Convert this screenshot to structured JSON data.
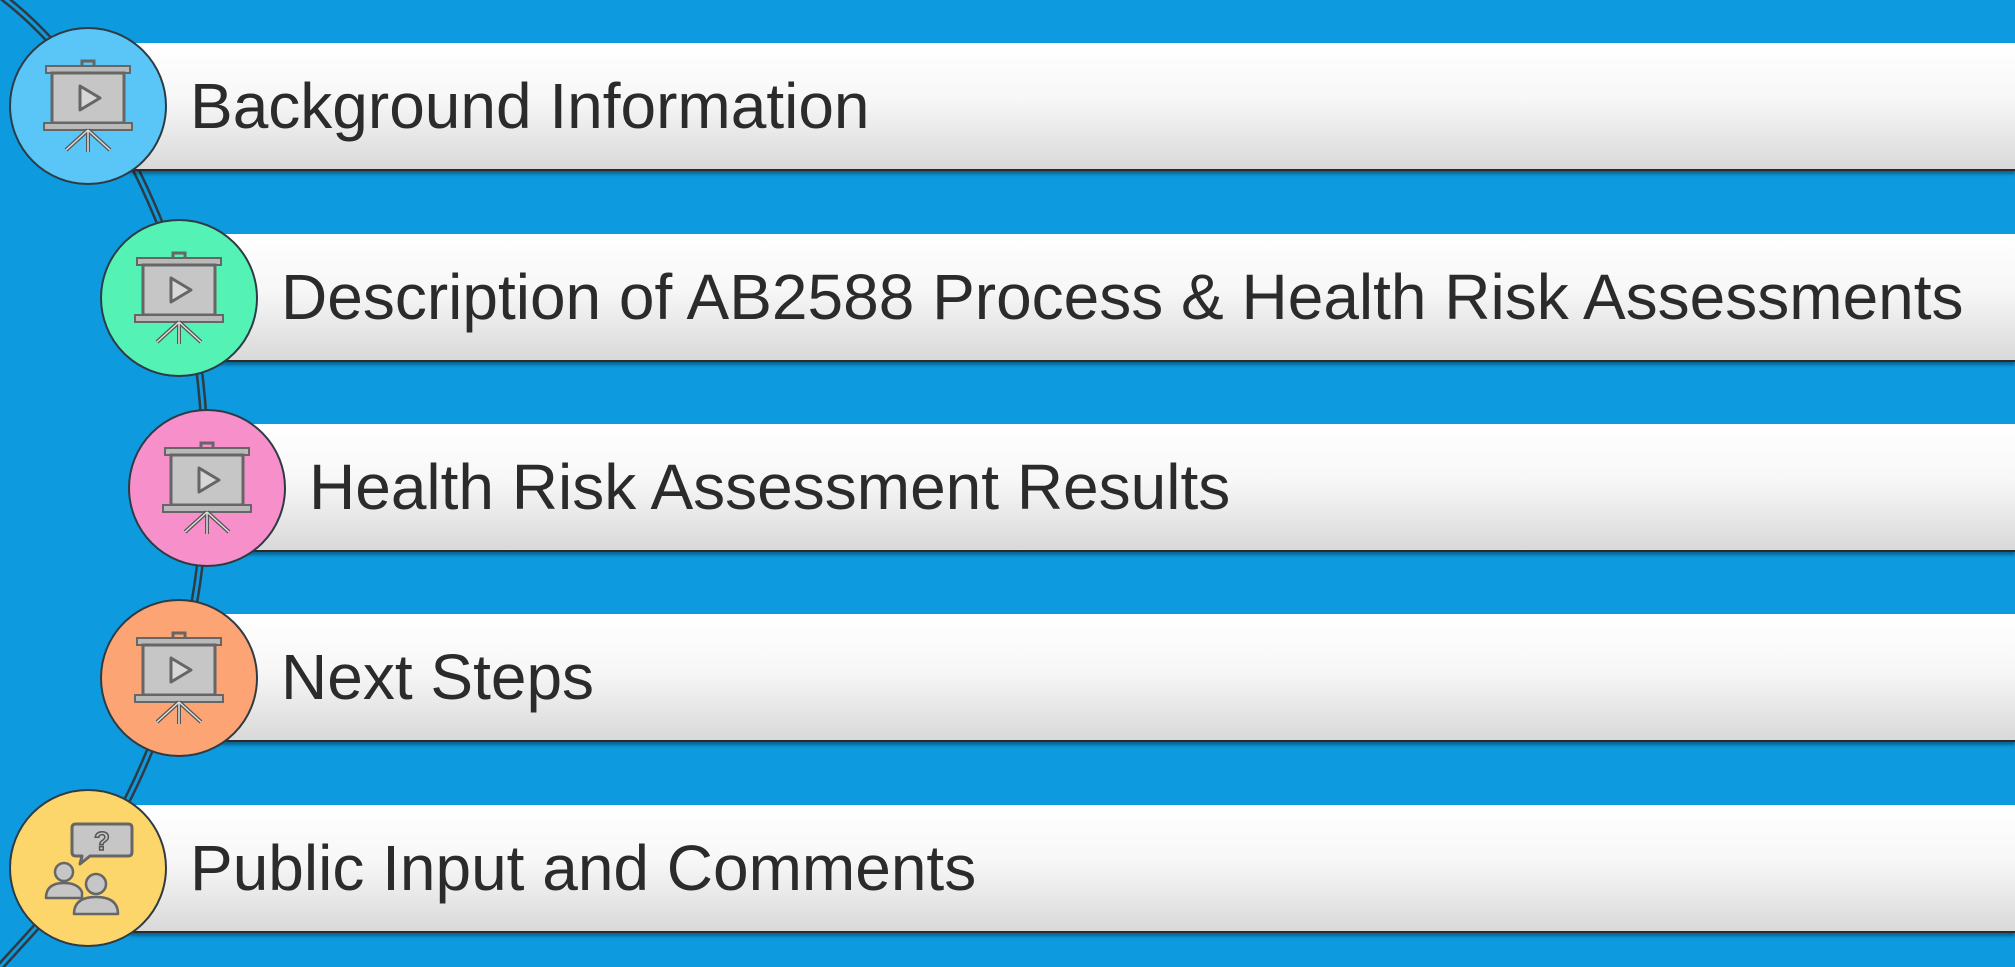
{
  "agenda": {
    "items": [
      {
        "label": "Background Information",
        "icon": "presentation-screen-icon",
        "color": "#59c6f7"
      },
      {
        "label": "Description of AB2588 Process & Health Risk Assessments",
        "icon": "presentation-screen-icon",
        "color": "#55f2b6"
      },
      {
        "label": "Health Risk Assessment Results",
        "icon": "presentation-screen-icon",
        "color": "#f78fcb"
      },
      {
        "label": "Next Steps",
        "icon": "presentation-screen-icon",
        "color": "#fca474"
      },
      {
        "label": "Public Input and Comments",
        "icon": "discussion-people-icon",
        "color": "#fcd66a"
      }
    ]
  },
  "colors": {
    "background": "#0d9ade",
    "bar": "#f2f2f2",
    "text": "#2b2b2b",
    "connector": "#2e3b44"
  }
}
